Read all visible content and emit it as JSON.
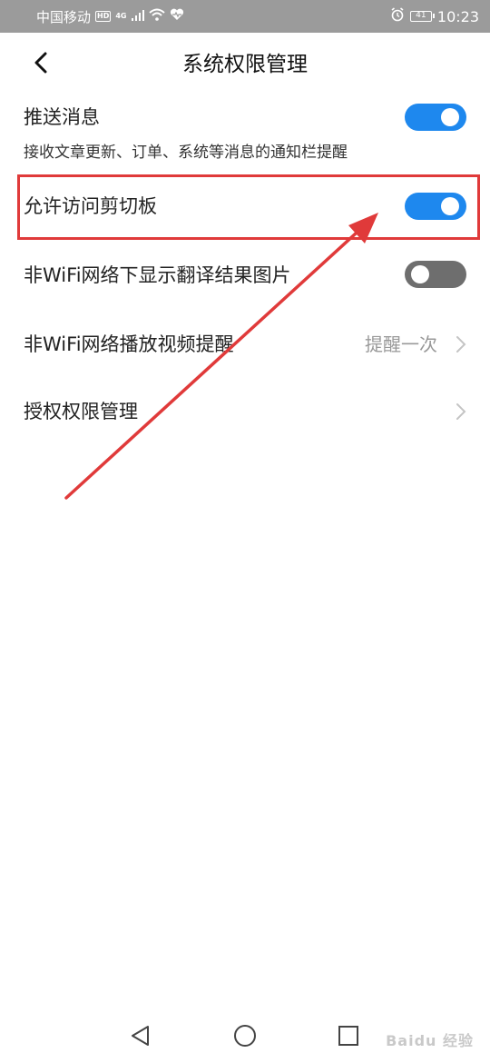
{
  "status_bar": {
    "carrier": "中国移动",
    "hd_badge": "HD",
    "network_type": "4G",
    "battery_level": "41",
    "time": "10:23",
    "icons": [
      "signal-icon",
      "wifi-icon",
      "health-icon",
      "alarm-icon",
      "battery-icon"
    ]
  },
  "header": {
    "title": "系统权限管理",
    "back_icon": "chevron-left-icon"
  },
  "settings": {
    "push": {
      "label": "推送消息",
      "description": "接收文章更新、订单、系统等消息的通知栏提醒",
      "enabled": true
    },
    "clipboard": {
      "label": "允许访问剪切板",
      "enabled": true
    },
    "non_wifi_images": {
      "label": "非WiFi网络下显示翻译结果图片",
      "enabled": false
    },
    "non_wifi_video": {
      "label": "非WiFi网络播放视频提醒",
      "value": "提醒一次"
    },
    "authorization": {
      "label": "授权权限管理"
    }
  },
  "colors": {
    "toggle_on": "#1e88ee",
    "toggle_off": "#6e6e6e",
    "annotation": "#e03a3a",
    "status_bar_bg": "#9b9b9b"
  },
  "nav_bar": {
    "icons": [
      "back-triangle-icon",
      "home-circle-icon",
      "recents-square-icon"
    ]
  },
  "watermark": "Baidu 经验"
}
